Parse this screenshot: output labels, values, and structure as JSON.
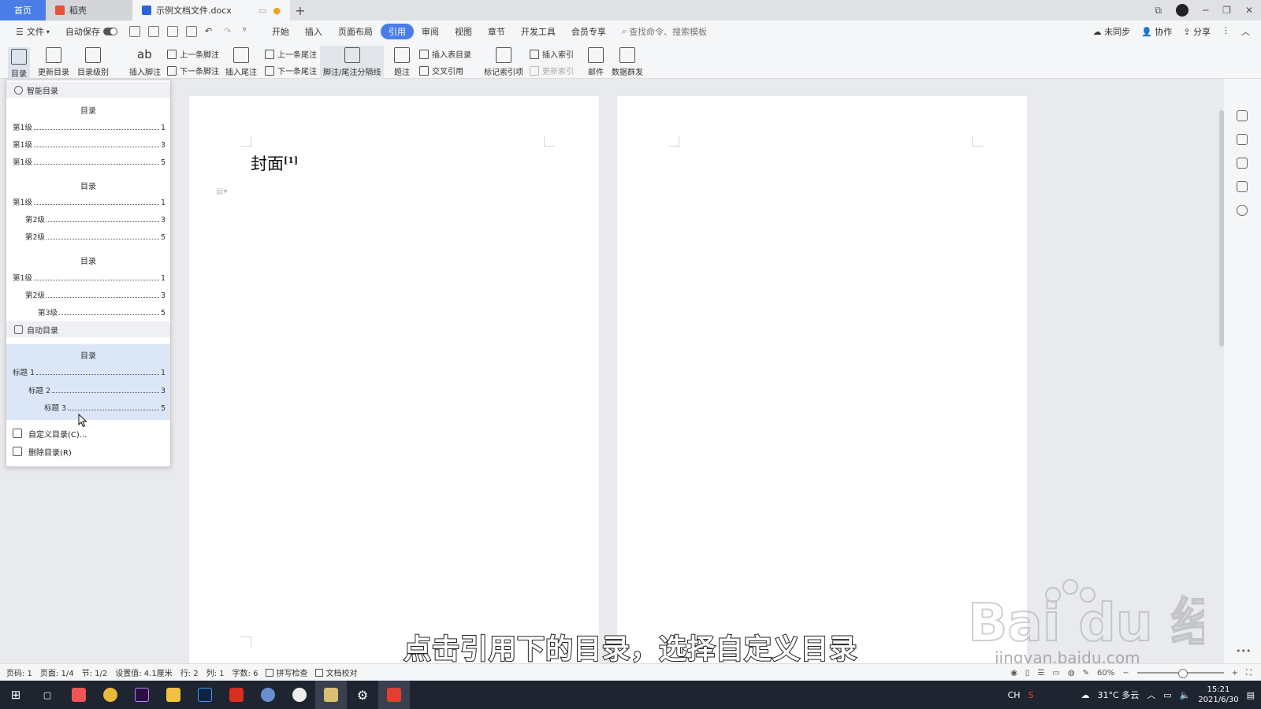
{
  "titlebar": {
    "tabs": [
      {
        "label": "首页",
        "icon": "home"
      },
      {
        "label": "稻壳",
        "icon": "daoke-logo-icon"
      },
      {
        "label": "示例文档文件.docx",
        "icon": "word-doc-icon"
      }
    ],
    "new_tab": "+"
  },
  "menubar": {
    "file": "文件",
    "autosave": "自动保存",
    "tabs": [
      "开始",
      "插入",
      "页面布局",
      "引用",
      "审阅",
      "视图",
      "章节",
      "开发工具",
      "会员专享"
    ],
    "active_tab": "引用",
    "search_placeholder": "查找命令、搜索模板",
    "right": {
      "sync": "未同步",
      "collab": "协作",
      "share": "分享"
    }
  },
  "ribbon": {
    "toc": "目录",
    "update_toc": "更新目录",
    "toc_level": "目录级别",
    "insert_footnote": "插入脚注",
    "prev_footnote": "上一条脚注",
    "next_footnote": "下一条脚注",
    "insert_endnote": "插入尾注",
    "prev_endnote": "上一条尾注",
    "next_endnote": "下一条尾注",
    "separator": "脚注/尾注分隔线",
    "caption": "题注",
    "insert_table_of_figures": "插入表目录",
    "cross_ref": "交叉引用",
    "mark_index": "标记索引项",
    "insert_index": "插入索引",
    "update_index": "更新索引",
    "mail": "邮件",
    "data_mail": "数据群发"
  },
  "dropdown": {
    "smart_toc_header": "智能目录",
    "smart_tocs": [
      {
        "title": "目录",
        "rows": [
          {
            "label": "第1级",
            "page": "1",
            "indent": 0
          },
          {
            "label": "第1级",
            "page": "3",
            "indent": 0
          },
          {
            "label": "第1级",
            "page": "5",
            "indent": 0
          }
        ]
      },
      {
        "title": "目录",
        "rows": [
          {
            "label": "第1级",
            "page": "1",
            "indent": 0
          },
          {
            "label": "第2级",
            "page": "3",
            "indent": 1
          },
          {
            "label": "第2级",
            "page": "5",
            "indent": 1
          }
        ]
      },
      {
        "title": "目录",
        "rows": [
          {
            "label": "第1级",
            "page": "1",
            "indent": 0
          },
          {
            "label": "第2级",
            "page": "3",
            "indent": 1
          },
          {
            "label": "第3级",
            "page": "5",
            "indent": 2
          }
        ]
      }
    ],
    "auto_toc_header": "自动目录",
    "auto_toc": {
      "title": "目录",
      "rows": [
        {
          "label": "标题 1",
          "page": "1",
          "indent": 0
        },
        {
          "label": "标题 2",
          "page": "3",
          "indent": 1
        },
        {
          "label": "标题 3",
          "page": "5",
          "indent": 2
        }
      ]
    },
    "custom_toc": "自定义目录(C)...",
    "delete_toc": "删除目录(R)"
  },
  "document": {
    "heading": "封面",
    "footnote_ref": "[1]"
  },
  "statusbar": {
    "page_num": "页码: 1",
    "pages": "页面: 1/4",
    "section": "节: 1/2",
    "setting": "设置值: 4.1厘米",
    "row": "行: 2",
    "col": "列: 1",
    "words": "字数: 6",
    "spellcheck": "拼写检查",
    "doc_check": "文档校对",
    "zoom": "60%"
  },
  "subtitle": "点击引用下的目录，选择自定义目录",
  "watermark": {
    "logo": "Bai  du 经验",
    "url": "jingyan.baidu.com"
  },
  "taskbar": {
    "weather": "31°C 多云",
    "ime": "CH",
    "time": "15:21",
    "date": "2021/6/30"
  },
  "colors": {
    "accent": "#4a7de8",
    "highlight": "#dbe7f7",
    "taskbar": "#1e2430"
  }
}
